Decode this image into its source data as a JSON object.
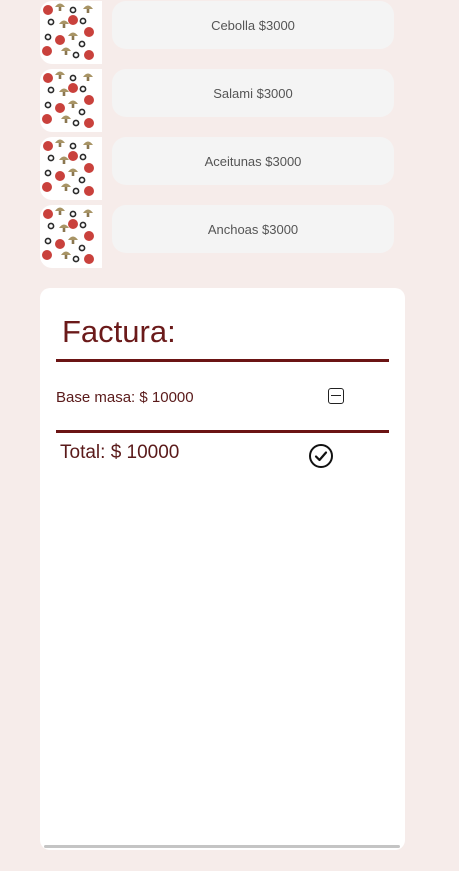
{
  "ingredients": [
    {
      "label": "Cebolla $3000",
      "thumbnail": "toppings-thumbnail"
    },
    {
      "label": "Salami $3000",
      "thumbnail": "toppings-thumbnail"
    },
    {
      "label": "Aceitunas $3000",
      "thumbnail": "toppings-thumbnail"
    },
    {
      "label": "Anchoas $3000",
      "thumbnail": "toppings-thumbnail"
    }
  ],
  "invoice": {
    "title": "Factura:",
    "items": [
      {
        "label": "Base masa: $ 10000",
        "action_icon": "minus-square-icon"
      }
    ],
    "total_label": "Total: $ 10000",
    "confirm_icon": "check-circle-icon"
  },
  "colors": {
    "background": "#f6ecea",
    "accent": "#6b1414",
    "panel": "#ffffff",
    "button": "#f4f4f4"
  }
}
